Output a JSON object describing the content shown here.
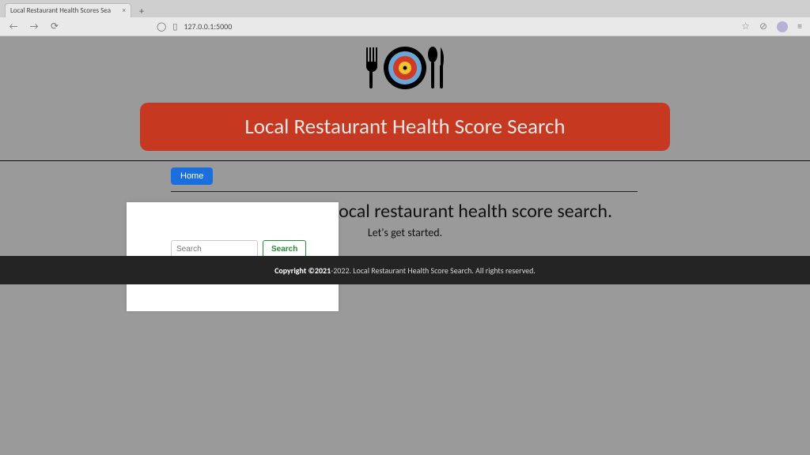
{
  "browser": {
    "tab_title": "Local Restaurant Health Scores Sea",
    "url": "127.0.0.1:5000"
  },
  "logo": {
    "name": "plate-target-fork-spoon-knife"
  },
  "hero": {
    "title": "Local Restaurant Health Score Search"
  },
  "nav": {
    "home": "Home"
  },
  "main": {
    "headline": "Welcome to your local restaurant health score search.",
    "subhead": "Let's get started."
  },
  "search": {
    "placeholder": "Search",
    "button": "Search"
  },
  "footer": {
    "bold": "Copyright ©2021",
    "rest": "-2022. Local Restaurant Health Score Search. All rights reserved."
  }
}
